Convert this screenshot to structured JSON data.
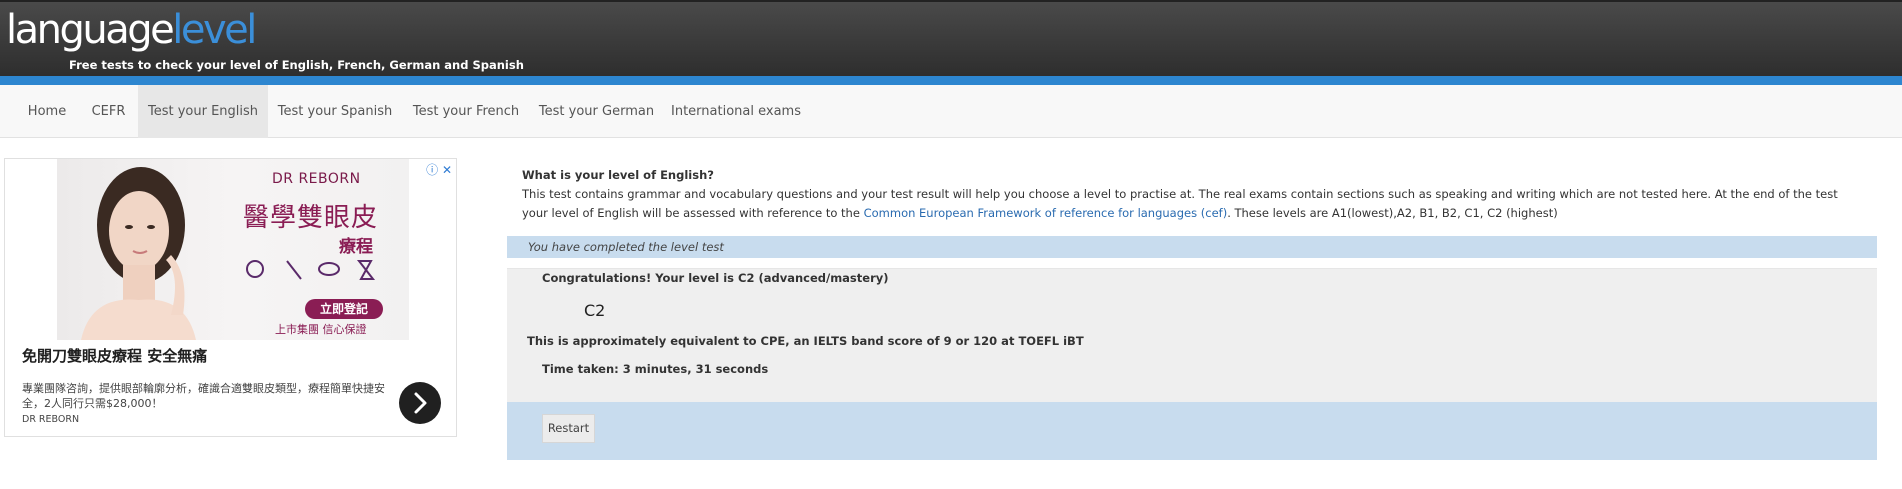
{
  "header": {
    "logo_part1": "language",
    "logo_part2": "level",
    "tagline": "Free tests to check your level of English, French, German and Spanish"
  },
  "nav": {
    "items": [
      {
        "label": "Home"
      },
      {
        "label": "CEFR"
      },
      {
        "label": "Test your English",
        "active": true
      },
      {
        "label": "Test your Spanish"
      },
      {
        "label": "Test your French"
      },
      {
        "label": "Test your German"
      },
      {
        "label": "International exams"
      }
    ]
  },
  "ad": {
    "brand": "DR REBORN",
    "image_headline": "醫學雙眼皮",
    "image_sub": "療程",
    "image_cta": "立即登記",
    "image_footer": "上市集團 信心保證",
    "title": "免開刀雙眼皮療程 安全無痛",
    "description": "專業團隊咨詢，提供眼部輪廓分析，確識合適雙眼皮類型，療程簡單快捷安全，2人同行只需$28,000！",
    "advertiser": "DR REBORN"
  },
  "main": {
    "intro_title": "What is your level of English?",
    "intro_text_before": "This test contains grammar and vocabulary questions and your test result will help you choose a level to practise at. The real exams contain sections such as speaking and writing which are not tested here. At the end of the test your level of English will be assessed with reference to the ",
    "intro_link": "Common European Framework of reference for languages (cef)",
    "intro_text_after": ". These levels are A1(lowest),A2, B1, B2, C1, C2 (highest)",
    "completed": "You have completed the level test",
    "congrats": "Congratulations! Your level is C2 (advanced/mastery)",
    "level_code": "C2",
    "equivalent": "This is approximately equivalent to CPE, an IELTS band score of 9 or 120 at TOEFL iBT",
    "time_taken": "Time taken: 3 minutes, 31 seconds",
    "restart_label": "Restart"
  },
  "colors": {
    "header_bg": "#3a3a3a",
    "accent_blue": "#2d86d0",
    "logo_blue": "#3b8fd9",
    "result_bar": "#c8dcee",
    "result_box": "#efefef",
    "link": "#2a6bb0"
  }
}
